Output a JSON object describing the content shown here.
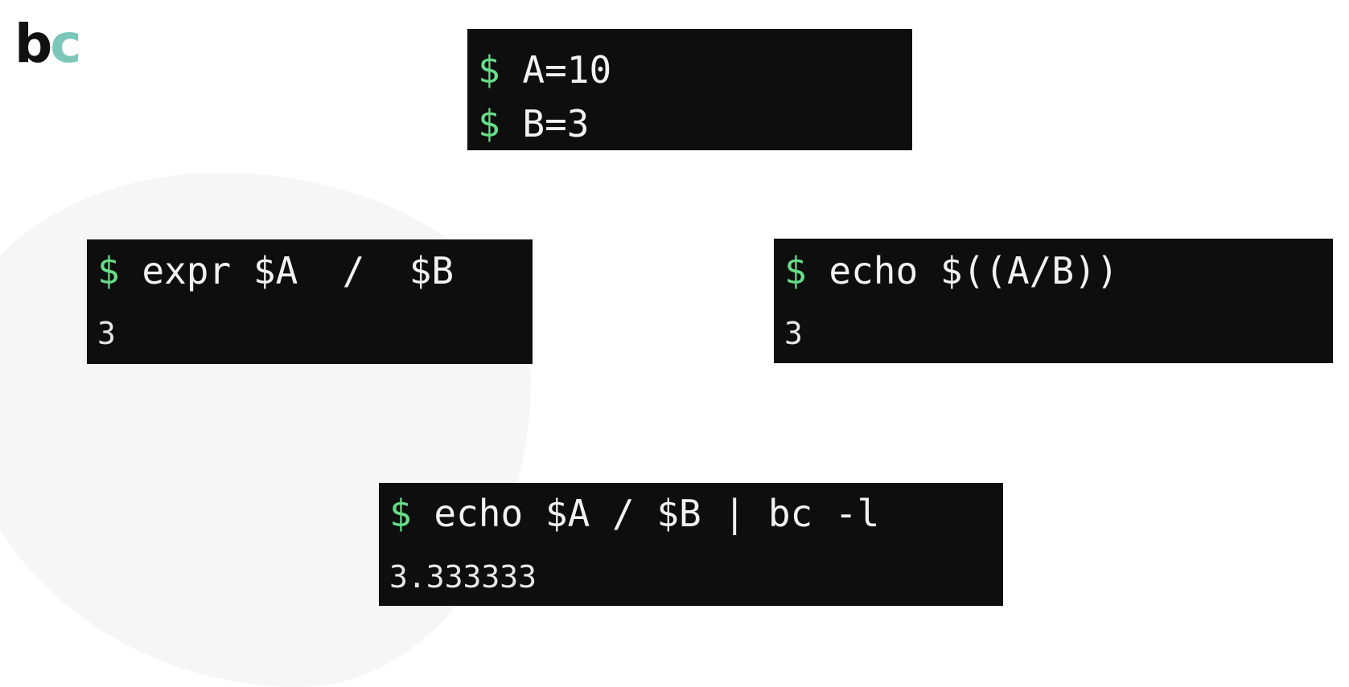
{
  "logo": {
    "b": "b",
    "c": "c"
  },
  "terminals": {
    "vars": {
      "prompt": "$",
      "line1": " A=10",
      "line2": " B=3"
    },
    "expr": {
      "prompt": "$",
      "command": " expr $A  /  $B",
      "output": "3"
    },
    "arith": {
      "prompt": "$",
      "command": " echo $((A/B))",
      "output": "3"
    },
    "bc": {
      "prompt": "$",
      "command": " echo $A / $B | bc -l",
      "output": "3.333333"
    }
  },
  "colors": {
    "terminal_bg": "#0e0e0e",
    "prompt": "#66dd88",
    "logo_b": "#111111",
    "logo_c": "#7cc7b9"
  }
}
